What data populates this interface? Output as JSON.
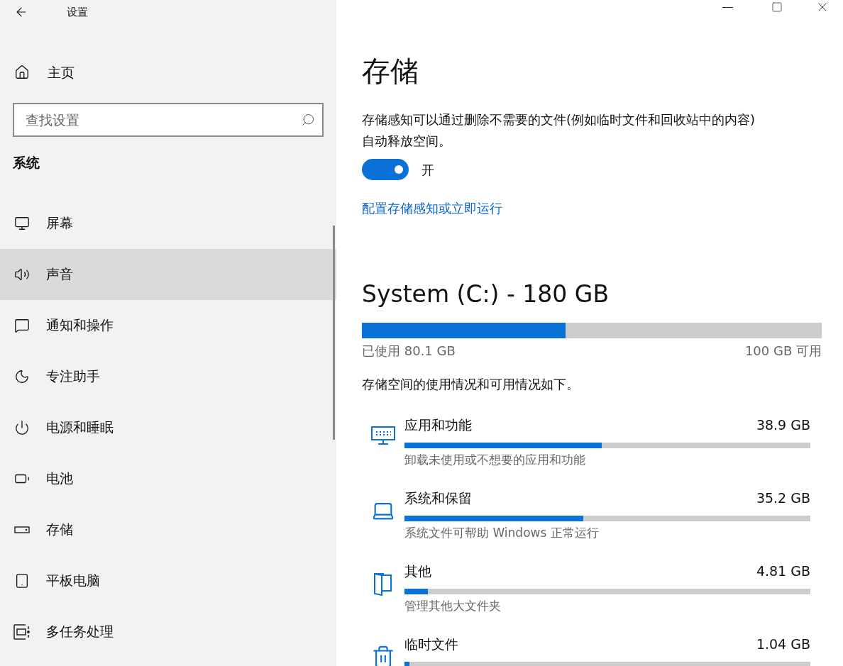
{
  "window": {
    "title": "设置"
  },
  "sidebar": {
    "home": "主页",
    "search": {
      "placeholder": "查找设置"
    },
    "section": "系统",
    "items": [
      {
        "label": "屏幕",
        "selected": false
      },
      {
        "label": "声音",
        "selected": true
      },
      {
        "label": "通知和操作",
        "selected": false
      },
      {
        "label": "专注助手",
        "selected": false
      },
      {
        "label": "电源和睡眠",
        "selected": false
      },
      {
        "label": "电池",
        "selected": false
      },
      {
        "label": "存储",
        "selected": false
      },
      {
        "label": "平板电脑",
        "selected": false
      },
      {
        "label": "多任务处理",
        "selected": false
      }
    ]
  },
  "page": {
    "title": "存储",
    "description": "存储感知可以通过删除不需要的文件(例如临时文件和回收站中的内容)自动释放空间。",
    "toggle": {
      "on": true,
      "label": "开"
    },
    "link": "配置存储感知或立即运行",
    "drive": {
      "title": "System (C:) - 180 GB",
      "level": 0.443,
      "used": "已使用 80.1 GB",
      "free": "100 GB 可用"
    },
    "summary": "存储空间的使用情况和可用情况如下。",
    "categories": [
      {
        "name": "应用和功能",
        "size": "38.9 GB",
        "level": 0.486,
        "description": "卸载未使用或不想要的应用和功能"
      },
      {
        "name": "系统和保留",
        "size": "35.2 GB",
        "level": 0.44,
        "description": "系统文件可帮助 Windows 正常运行"
      },
      {
        "name": "其他",
        "size": "4.81 GB",
        "level": 0.058,
        "description": "管理其他大文件夹"
      },
      {
        "name": "临时文件",
        "size": "1.04 GB",
        "level": 0.012
      }
    ]
  }
}
